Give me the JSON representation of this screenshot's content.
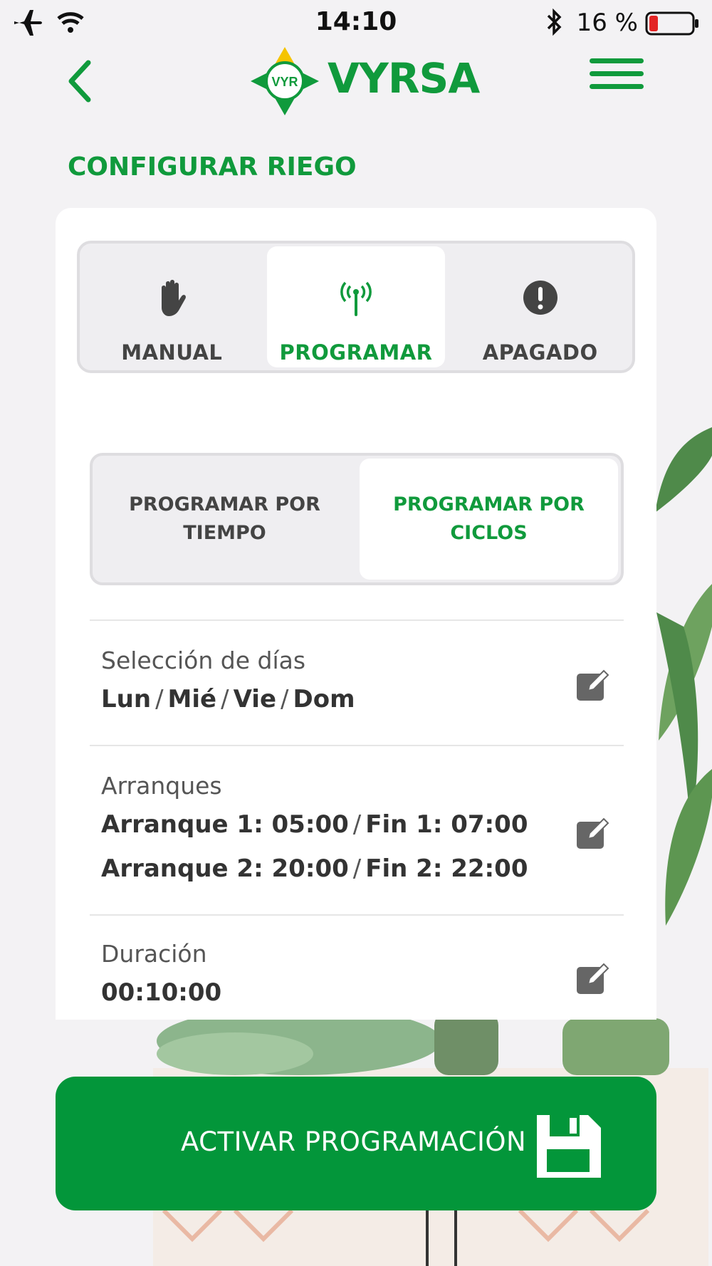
{
  "status_bar": {
    "time": "14:10",
    "battery": "16 %",
    "icons": [
      "airplane-icon",
      "wifi-icon",
      "bluetooth-icon",
      "battery-icon"
    ]
  },
  "header": {
    "logo_badge": "VYR",
    "logo_text": "VYRSA",
    "back_icon": "chevron-left-icon",
    "menu_icon": "hamburger-menu-icon"
  },
  "page": {
    "title": "CONFIGURAR RIEGO"
  },
  "modes": [
    {
      "label": "MANUAL",
      "icon": "hand-icon",
      "active": false
    },
    {
      "label": "PROGRAMAR",
      "icon": "antenna-icon",
      "active": true
    },
    {
      "label": "APAGADO",
      "icon": "alert-icon",
      "active": false
    }
  ],
  "program_types": [
    {
      "label": "PROGRAMAR POR TIEMPO",
      "active": false
    },
    {
      "label": "PROGRAMAR POR CICLOS",
      "active": true
    }
  ],
  "settings": {
    "days": {
      "label": "Selección de días",
      "values": [
        "Lun",
        "Mié",
        "Vie",
        "Dom"
      ]
    },
    "starts": {
      "label": "Arranques",
      "line1_start": "Arranque 1: 05:00",
      "line1_end": "Fin 1: 07:00",
      "line2_start": "Arranque 2: 20:00",
      "line2_end": "Fin 2: 22:00"
    },
    "duration": {
      "label": "Duración",
      "value": "00:10:00"
    },
    "separator": "/"
  },
  "action": {
    "label": "ACTIVAR PROGRAMACIÓN",
    "icon": "save-icon"
  },
  "colors": {
    "brand_green": "#109a3c",
    "button_green": "#03963a",
    "logo_yellow": "#f5c400",
    "background": "#f3f2f4",
    "battery_low": "#e32424"
  }
}
